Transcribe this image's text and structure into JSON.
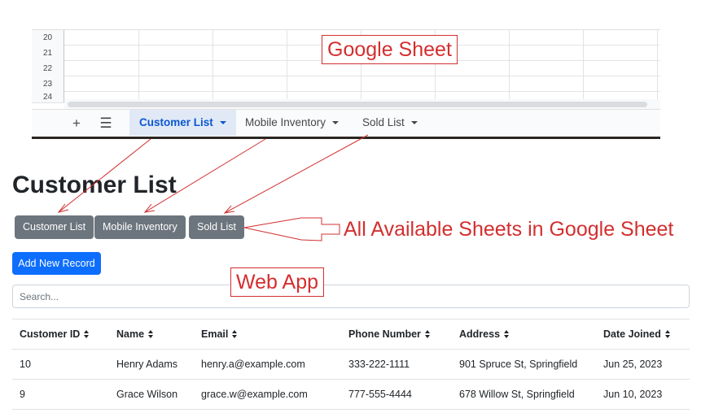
{
  "sheet": {
    "row_numbers": [
      "20",
      "21",
      "22",
      "23",
      "24"
    ],
    "tabs": [
      {
        "label": "Customer List",
        "active": true
      },
      {
        "label": "Mobile Inventory",
        "active": false
      },
      {
        "label": "Sold List",
        "active": false
      }
    ],
    "add_icon": "plus-icon",
    "menu_icon": "hamburger-menu-icon"
  },
  "annotations": {
    "google_sheet": "Google Sheet",
    "available_sheets": "All Available Sheets in Google Sheet",
    "web_app": "Web App",
    "color": "#d32f2f"
  },
  "app": {
    "title": "Customer List",
    "sheet_buttons": [
      "Customer List",
      "Mobile Inventory",
      "Sold List"
    ],
    "add_button": "Add New Record",
    "search_placeholder": "Search...",
    "table": {
      "columns": [
        "Customer ID",
        "Name",
        "Email",
        "Phone Number",
        "Address",
        "Date Joined"
      ],
      "rows": [
        [
          "10",
          "Henry Adams",
          "henry.a@example.com",
          "333-222-1111",
          "901 Spruce St, Springfield",
          "Jun 25, 2023"
        ],
        [
          "9",
          "Grace Wilson",
          "grace.w@example.com",
          "777-555-4444",
          "678 Willow St, Springfield",
          "Jun 10, 2023"
        ]
      ]
    }
  },
  "colors": {
    "sheet_active_tab": "#0b57d0",
    "secondary_button": "#6c757d",
    "primary_button": "#0d6efd"
  }
}
